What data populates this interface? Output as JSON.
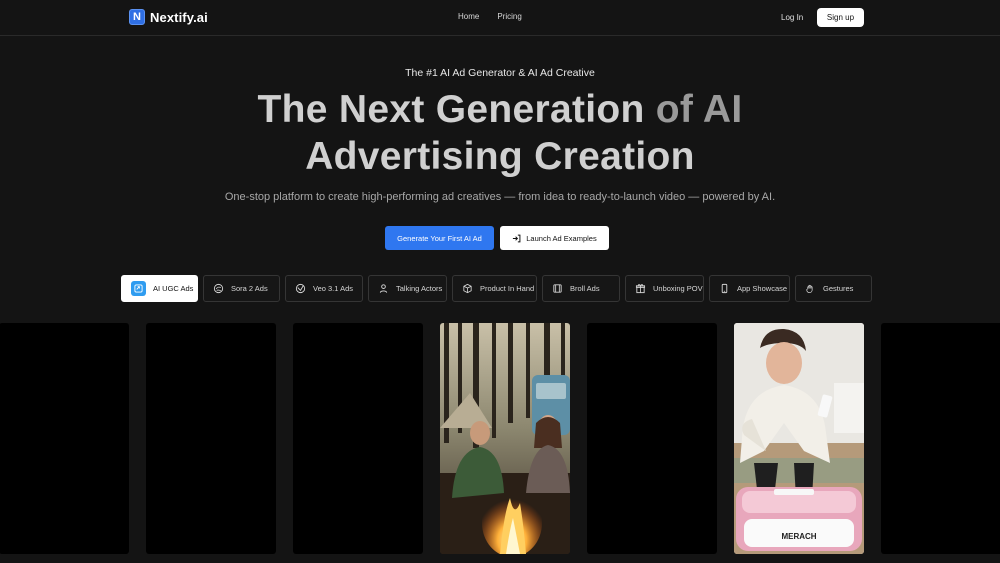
{
  "brand": {
    "name": "Nextify.ai",
    "logo_letter": "N",
    "accent": "#2f77f0"
  },
  "nav": {
    "links": [
      "Home",
      "Pricing"
    ],
    "login": "Log In",
    "signup": "Sign up"
  },
  "hero": {
    "eyebrow": "The #1 AI Ad Generator & AI Ad Creative",
    "headline_a": "The Next Generation ",
    "headline_b": "of AI",
    "headline_c": "Advertising Creation",
    "subline": "One-stop platform to create high-performing ad creatives — from idea to ready-to-launch video — powered by AI.",
    "cta_primary": "Generate Your First AI Ad",
    "cta_secondary": "Launch Ad Examples"
  },
  "tabs": [
    {
      "label": "AI UGC Ads",
      "icon": "ugc-icon",
      "active": true
    },
    {
      "label": "Sora 2 Ads",
      "icon": "sora-icon"
    },
    {
      "label": "Veo 3.1 Ads",
      "icon": "veo-icon"
    },
    {
      "label": "Talking Actors",
      "icon": "person-icon"
    },
    {
      "label": "Product In Hand",
      "icon": "box-icon"
    },
    {
      "label": "Broll Ads",
      "icon": "film-icon"
    },
    {
      "label": "Unboxing POV",
      "icon": "gift-icon"
    },
    {
      "label": "App Showcase",
      "icon": "phone-icon"
    },
    {
      "label": "Gestures",
      "icon": "hand-icon"
    }
  ],
  "cards": [
    {
      "kind": "blank"
    },
    {
      "kind": "blank"
    },
    {
      "kind": "blank"
    },
    {
      "kind": "campfire-video"
    },
    {
      "kind": "blank"
    },
    {
      "kind": "fitness-video",
      "product_text": "MERACH"
    },
    {
      "kind": "blank"
    }
  ]
}
